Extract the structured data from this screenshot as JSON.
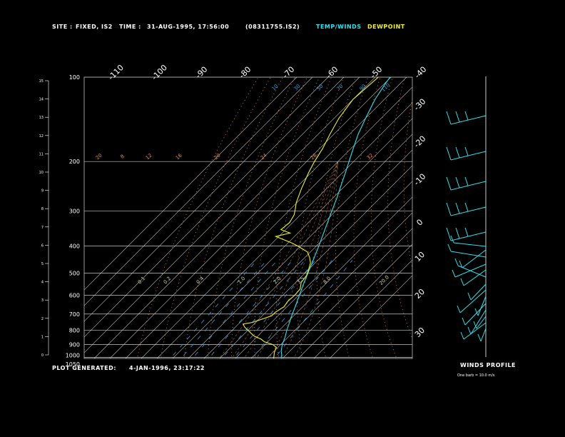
{
  "header": {
    "site_label": "SITE :",
    "site_value": "FIXED, IS2",
    "time_label": "TIME :",
    "time_value": "31-AUG-1995, 17:56:00",
    "file_id": "(08311755.IS2)",
    "legend_temp": "TEMP/WINDS",
    "legend_dew": "DEWPOINT"
  },
  "footer": {
    "generated_label": "PLOT GENERATED:",
    "generated_value": "4-JAN-1996, 23:17:22",
    "winds_title": "WINDS PROFILE",
    "winds_note": "One barb = 10.0 m/s"
  },
  "colors": {
    "background": "#000000",
    "temp": "#33e0ea",
    "dewpoint": "#f0f030",
    "isobar": "#c8c8c8",
    "isotherm": "#c8c8c8",
    "mixing_ratio": "#33a8e0",
    "dry_adiabat": "#e0905a",
    "moist_adiabat": "#c0c0ff"
  },
  "chart_data": {
    "type": "skew-t",
    "pressure_ticks": [
      "100",
      "200",
      "300",
      "400",
      "500",
      "600",
      "700",
      "800",
      "900",
      "1000",
      "1050"
    ],
    "height_ticks_km": [
      "0",
      "1",
      "2",
      "3",
      "4",
      "5",
      "6",
      "7",
      "8",
      "9",
      "10",
      "11",
      "12",
      "13",
      "14",
      "15"
    ],
    "isotherm_labels_top": [
      "-110",
      "-100",
      "-90",
      "-80",
      "-70",
      "-60",
      "-50",
      "-40"
    ],
    "isotherm_labels_right": [
      "-30",
      "-20",
      "-10",
      "0",
      "10",
      "20",
      "30"
    ],
    "dry_adiabat_labels": [
      "20",
      "8",
      "12",
      "16",
      "20",
      "24",
      "28",
      "32"
    ],
    "mixing_ratio_labels": [
      "0.1",
      "0.2",
      "0.4",
      "1.0",
      "2.0",
      "3.5",
      "8.0",
      "20.0"
    ],
    "moist_adiabat_labels": [
      "110",
      "90",
      "70",
      "50",
      "30",
      "10"
    ],
    "temperature": [
      {
        "p": 1030,
        "t": 30.5
      },
      {
        "p": 1010,
        "t": 29.5
      },
      {
        "p": 1000,
        "t": 28.5
      },
      {
        "p": 980,
        "t": 27.3
      },
      {
        "p": 950,
        "t": 24.5
      },
      {
        "p": 900,
        "t": 21.0
      },
      {
        "p": 850,
        "t": 18.3
      },
      {
        "p": 800,
        "t": 14.8
      },
      {
        "p": 750,
        "t": 11.5
      },
      {
        "p": 700,
        "t": 8.0
      },
      {
        "p": 650,
        "t": 4.5
      },
      {
        "p": 600,
        "t": 0.5
      },
      {
        "p": 550,
        "t": -3.8
      },
      {
        "p": 500,
        "t": -8.2
      },
      {
        "p": 450,
        "t": -13.0
      },
      {
        "p": 400,
        "t": -18.5
      },
      {
        "p": 350,
        "t": -25.0
      },
      {
        "p": 300,
        "t": -32.5
      },
      {
        "p": 270,
        "t": -37.5
      },
      {
        "p": 250,
        "t": -41.5
      },
      {
        "p": 220,
        "t": -48.0
      },
      {
        "p": 200,
        "t": -53.0
      },
      {
        "p": 180,
        "t": -58.5
      },
      {
        "p": 160,
        "t": -64.5
      },
      {
        "p": 140,
        "t": -70.0
      },
      {
        "p": 120,
        "t": -76.0
      },
      {
        "p": 105,
        "t": -79.5
      },
      {
        "p": 100,
        "t": -80.5
      }
    ],
    "dewpoint": [
      {
        "p": 1030,
        "t": 25.5
      },
      {
        "p": 1000,
        "t": 23.8
      },
      {
        "p": 960,
        "t": 21.0
      },
      {
        "p": 920,
        "t": 19.0
      },
      {
        "p": 900,
        "t": 15.0
      },
      {
        "p": 880,
        "t": 8.0
      },
      {
        "p": 860,
        "t": 4.0
      },
      {
        "p": 840,
        "t": -2.0
      },
      {
        "p": 820,
        "t": -6.0
      },
      {
        "p": 800,
        "t": -10.0
      },
      {
        "p": 780,
        "t": -14.0
      },
      {
        "p": 760,
        "t": -17.0
      },
      {
        "p": 750,
        "t": -12.0
      },
      {
        "p": 730,
        "t": -8.0
      },
      {
        "p": 710,
        "t": -4.0
      },
      {
        "p": 690,
        "t": -4.0
      },
      {
        "p": 660,
        "t": -2.0
      },
      {
        "p": 630,
        "t": -3.0
      },
      {
        "p": 600,
        "t": -2.5
      },
      {
        "p": 570,
        "t": -3.0
      },
      {
        "p": 540,
        "t": -6.5
      },
      {
        "p": 510,
        "t": -7.5
      },
      {
        "p": 490,
        "t": -9.5
      },
      {
        "p": 460,
        "t": -13.0
      },
      {
        "p": 440,
        "t": -17.0
      },
      {
        "p": 420,
        "t": -22.0
      },
      {
        "p": 410,
        "t": -27.0
      },
      {
        "p": 400,
        "t": -32.0
      },
      {
        "p": 390,
        "t": -38.0
      },
      {
        "p": 370,
        "t": -52.0
      },
      {
        "p": 360,
        "t": -45.0
      },
      {
        "p": 350,
        "t": -53.0
      },
      {
        "p": 330,
        "t": -52.0
      },
      {
        "p": 310,
        "t": -54.0
      },
      {
        "p": 300,
        "t": -56.0
      },
      {
        "p": 280,
        "t": -60.5
      },
      {
        "p": 250,
        "t": -66.0
      },
      {
        "p": 220,
        "t": -71.5
      },
      {
        "p": 200,
        "t": -75.0
      },
      {
        "p": 180,
        "t": -78.0
      },
      {
        "p": 160,
        "t": -82.5
      },
      {
        "p": 140,
        "t": -87.0
      },
      {
        "p": 120,
        "t": -90.0
      },
      {
        "p": 100,
        "t": -88.0
      }
    ]
  }
}
